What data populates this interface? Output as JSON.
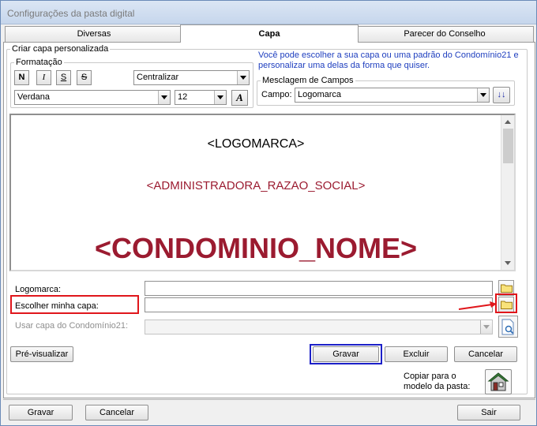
{
  "window": {
    "title": "Configurações da pasta digital"
  },
  "tabs": [
    {
      "label": "Diversas",
      "active": false
    },
    {
      "label": "Capa",
      "active": true
    },
    {
      "label": "Parecer do Conselho",
      "active": false
    }
  ],
  "capa": {
    "group_label": "Criar capa personalizada",
    "formatting": {
      "label": "Formatação",
      "bold": "N",
      "italic": "I",
      "underline": "S",
      "strike": "S",
      "alignment": "Centralizar",
      "font": "Verdana",
      "size": "12",
      "color_button": "A"
    },
    "hint": "Você pode escolher a sua capa ou uma padrão do Condomínio21 e personalizar uma delas da forma que quiser.",
    "merge": {
      "label": "Mesclagem de Campos",
      "field_label": "Campo:",
      "field_value": "Logomarca",
      "insert_button": "↓↓"
    },
    "editor": {
      "line1": "<LOGOMARCA>",
      "line2": "<ADMINISTRADORA_RAZAO_SOCIAL>",
      "line3": "<CONDOMINIO_NOME>",
      "accent_color": "#9b1b30"
    },
    "logomarca_label": "Logomarca:",
    "logomarca_value": "",
    "escolher_label": "Escolher minha capa:",
    "escolher_value": "",
    "usar_label": "Usar capa do Condomínio21:",
    "usar_value": "",
    "preview_button": "Pré-visualizar",
    "gravar_button": "Gravar",
    "excluir_button": "Excluir",
    "cancelar_button": "Cancelar",
    "copy_label": "Copiar para o modelo da pasta:"
  },
  "footer": {
    "gravar": "Gravar",
    "cancelar": "Cancelar",
    "sair": "Sair"
  },
  "colors": {
    "highlight_red": "#e0161b",
    "highlight_blue": "#1c20c8",
    "hint_text": "#1f3fbf"
  }
}
